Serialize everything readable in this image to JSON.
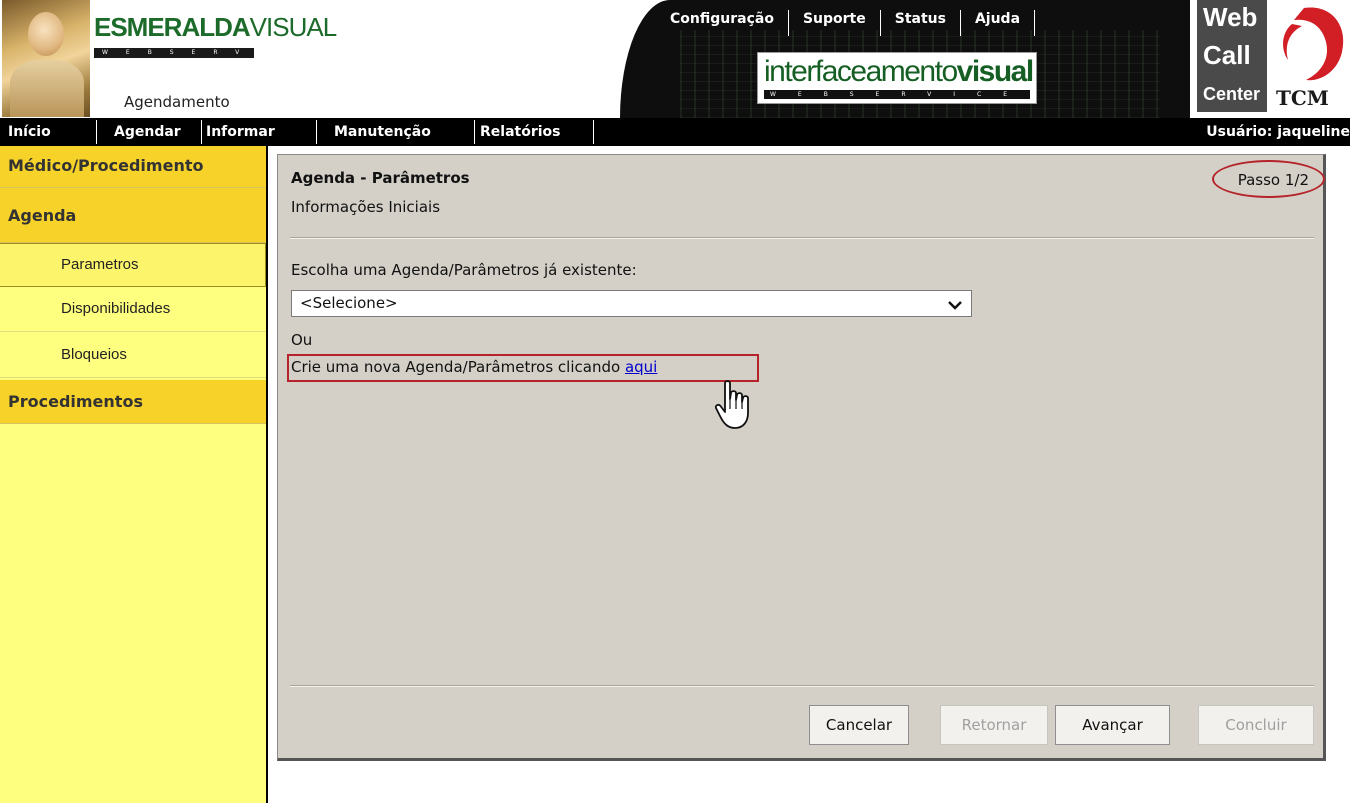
{
  "header": {
    "brand_bold": "ESMERALDA",
    "brand_light": "VISUAL",
    "brand_strip": "WEBSERVICE",
    "module": "Agendamento",
    "service_logo_light": "interfaceamento",
    "service_logo_bold": "visual",
    "service_strip": "WEBSERVICE",
    "webcall_line1": "Web",
    "webcall_line2": "Call",
    "webcall_line3": "Center",
    "tcm": "TCM",
    "top_nav": [
      "Configuração",
      "Suporte",
      "Status",
      "Ajuda"
    ]
  },
  "main_nav": {
    "items": [
      "Início",
      "Agendar",
      "Informar",
      "Manutenção",
      "Relatórios"
    ],
    "user": "Usuário: jaqueline"
  },
  "sidebar": {
    "sections": [
      "Médico/Procedimento",
      "Agenda",
      "Procedimentos"
    ],
    "agenda_items": [
      "Parametros",
      "Disponibilidades",
      "Bloqueios"
    ],
    "active_item": "Parametros"
  },
  "panel": {
    "title": "Agenda - Parâmetros",
    "subtitle": "Informações Iniciais",
    "step": "Passo 1/2",
    "choose_label": "Escolha uma Agenda/Parâmetros já existente:",
    "select_value": "<Selecione>",
    "or_label": "Ou",
    "create_text": "Crie uma nova Agenda/Parâmetros clicando",
    "create_link": "aqui"
  },
  "buttons": {
    "cancel": "Cancelar",
    "back": "Retornar",
    "next": "Avançar",
    "finish": "Concluir"
  },
  "colors": {
    "sidebar_bg": "#ffff7f",
    "sidebar_section": "#f7d229",
    "panel_bg": "#d4d0c8",
    "highlight_red": "#b5242a",
    "link_blue": "#0000cc"
  }
}
